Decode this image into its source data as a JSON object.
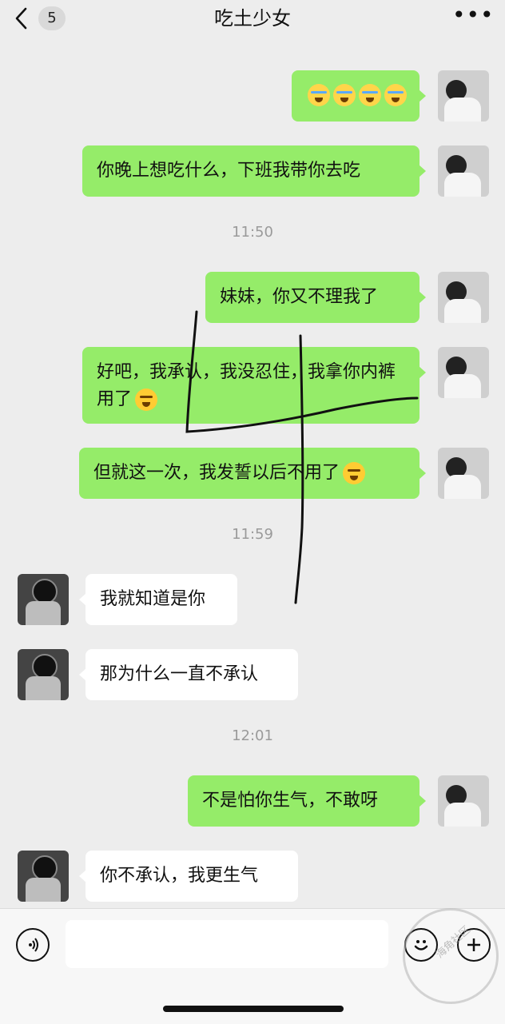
{
  "header": {
    "back_badge": "5",
    "title": "吃土少女",
    "more": "•••"
  },
  "messages": [
    {
      "side": "right",
      "type": "emoji",
      "emoji": [
        "cry",
        "cry",
        "cry",
        "cry"
      ]
    },
    {
      "side": "right",
      "type": "text",
      "text": "你晚上想吃什么，下班我带你去吃"
    },
    {
      "type": "time",
      "text": "11:50"
    },
    {
      "side": "right",
      "type": "text",
      "text": "妹妹，你又不理我了"
    },
    {
      "side": "right",
      "type": "text",
      "text": "好吧，我承认，我没忍住，我拿你内裤用了",
      "emoji": "tired"
    },
    {
      "side": "right",
      "type": "text",
      "text": "但就这一次，我发誓以后不用了",
      "emoji": "tired"
    },
    {
      "type": "time",
      "text": "11:59"
    },
    {
      "side": "left",
      "type": "text",
      "text": "我就知道是你"
    },
    {
      "side": "left",
      "type": "text",
      "text": "那为什么一直不承认"
    },
    {
      "type": "time",
      "text": "12:01"
    },
    {
      "side": "right",
      "type": "text",
      "text": "不是怕你生气，不敢呀"
    },
    {
      "side": "left",
      "type": "text",
      "text": "你不承认，我更生气"
    }
  ],
  "input": {
    "placeholder": ""
  },
  "icons": {
    "back": "chevron-left-icon",
    "voice": "voice-icon",
    "emoji": "emoji-icon",
    "plus": "plus-icon"
  },
  "watermark": "海角社区"
}
